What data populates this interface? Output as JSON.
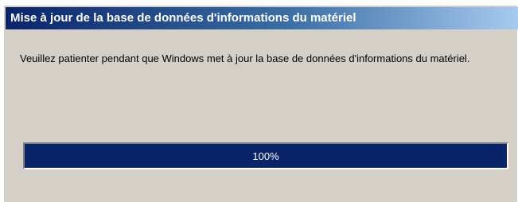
{
  "dialog": {
    "title": "Mise à jour de la base de données d'informations du matériel",
    "message": "Veuillez patienter pendant que Windows met à jour la base de données d'informations du matériel.",
    "progress": {
      "value_percent": 100,
      "label": "100%"
    }
  },
  "colors": {
    "titlebar_start": "#0a246a",
    "titlebar_end": "#a6caf0",
    "dialog_background": "#d4d0c8",
    "progress_fill": "#0a246a",
    "progress_text": "#ffffff"
  }
}
